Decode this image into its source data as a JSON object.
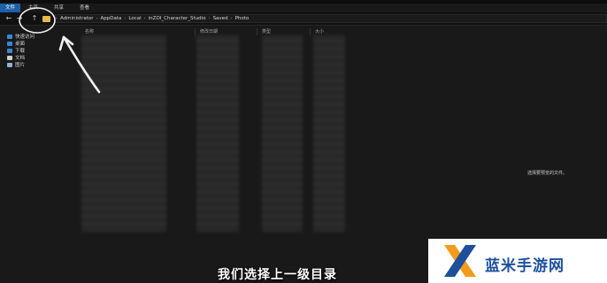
{
  "ribbon": {
    "tabs": [
      "文件",
      "主页",
      "共享",
      "查看"
    ]
  },
  "nav": {
    "back": "←",
    "forward": "→",
    "up": "↑"
  },
  "breadcrumb": [
    "Administrator",
    "AppData",
    "Local",
    "inZOI_Character_Studio",
    "Saved",
    "Photo"
  ],
  "sidebar": {
    "items": [
      {
        "label": "快速访问",
        "icon": "star-icon",
        "color": "#3a86d8"
      },
      {
        "label": "桌面",
        "icon": "desktop-icon",
        "color": "#3a86d8"
      },
      {
        "label": "下载",
        "icon": "download-icon",
        "color": "#3a86d8"
      },
      {
        "label": "文档",
        "icon": "document-icon",
        "color": "#cfcfcf"
      },
      {
        "label": "图片",
        "icon": "pictures-icon",
        "color": "#8fb4d6"
      }
    ]
  },
  "columns": [
    "名称",
    "修改日期",
    "类型",
    "大小"
  ],
  "preview": {
    "text": "选择要预览的文件。"
  },
  "subtitle": "我们选择上一级目录",
  "watermark": {
    "text": "蓝米手游网",
    "accent": "#f29b1d",
    "brand": "#1d4f9c"
  }
}
